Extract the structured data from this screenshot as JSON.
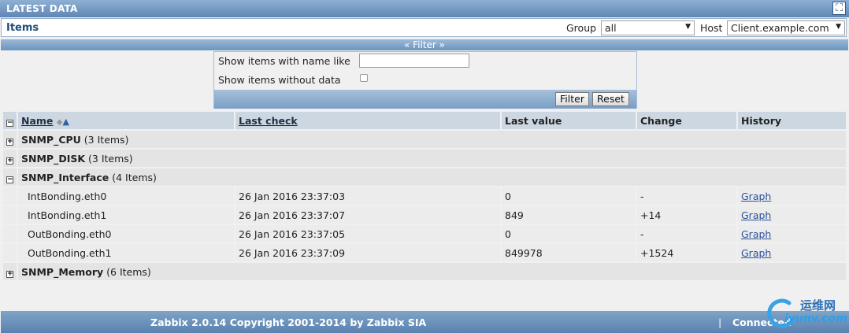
{
  "title": "LATEST DATA",
  "items_label": "Items",
  "group": {
    "label": "Group",
    "value": "all"
  },
  "host": {
    "label": "Host",
    "value": "Client.example.com"
  },
  "filter": {
    "toggle_label": "« Filter »",
    "name_like_label": "Show items with name like",
    "name_like_value": "",
    "without_data_label": "Show items without data",
    "filter_button": "Filter",
    "reset_button": "Reset"
  },
  "table": {
    "headers": {
      "name": "Name",
      "last_check": "Last check",
      "last_value": "Last value",
      "change": "Change",
      "history": "History"
    },
    "groups": [
      {
        "name": "SNMP_CPU",
        "count": "(3 Items)",
        "expanded": false
      },
      {
        "name": "SNMP_DISK",
        "count": "(3 Items)",
        "expanded": false
      },
      {
        "name": "SNMP_Interface",
        "count": "(4 Items)",
        "expanded": true
      },
      {
        "name": "SNMP_Memory",
        "count": "(6 Items)",
        "expanded": false
      }
    ],
    "rows": [
      {
        "name": "IntBonding.eth0",
        "last_check": "26 Jan 2016 23:37:03",
        "last_value": "0",
        "change": "-",
        "history": "Graph"
      },
      {
        "name": "IntBonding.eth1",
        "last_check": "26 Jan 2016 23:37:07",
        "last_value": "849",
        "change": "+14",
        "history": "Graph"
      },
      {
        "name": "OutBonding.eth0",
        "last_check": "26 Jan 2016 23:37:05",
        "last_value": "0",
        "change": "-",
        "history": "Graph"
      },
      {
        "name": "OutBonding.eth1",
        "last_check": "26 Jan 2016 23:37:09",
        "last_value": "849978",
        "change": "+1524",
        "history": "Graph"
      }
    ]
  },
  "footer": {
    "copyright": "Zabbix 2.0.14 Copyright 2001-2014 by Zabbix SIA",
    "separator": "|",
    "connected": "Connected"
  },
  "watermark": {
    "line1": "运维网",
    "line2": "iyunv.com"
  },
  "colors": {
    "header_blue": "#5f86b4",
    "link": "#2a4f9c"
  }
}
